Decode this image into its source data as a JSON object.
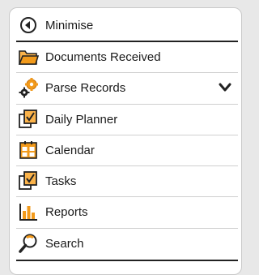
{
  "menu": {
    "minimise_label": "Minimise",
    "items": [
      {
        "label": "Documents Received",
        "icon": "folder-icon"
      },
      {
        "label": "Parse Records",
        "icon": "gears-icon"
      },
      {
        "label": "Daily Planner",
        "icon": "checklist-icon"
      },
      {
        "label": "Calendar",
        "icon": "calendar-icon"
      },
      {
        "label": "Tasks",
        "icon": "checklist-icon"
      },
      {
        "label": "Reports",
        "icon": "bar-chart-icon"
      },
      {
        "label": "Search",
        "icon": "magnifier-icon"
      }
    ]
  },
  "colors": {
    "accent_orange": "#f29a1b",
    "text": "#1a1a1a",
    "separator": "#cfcfcf"
  }
}
